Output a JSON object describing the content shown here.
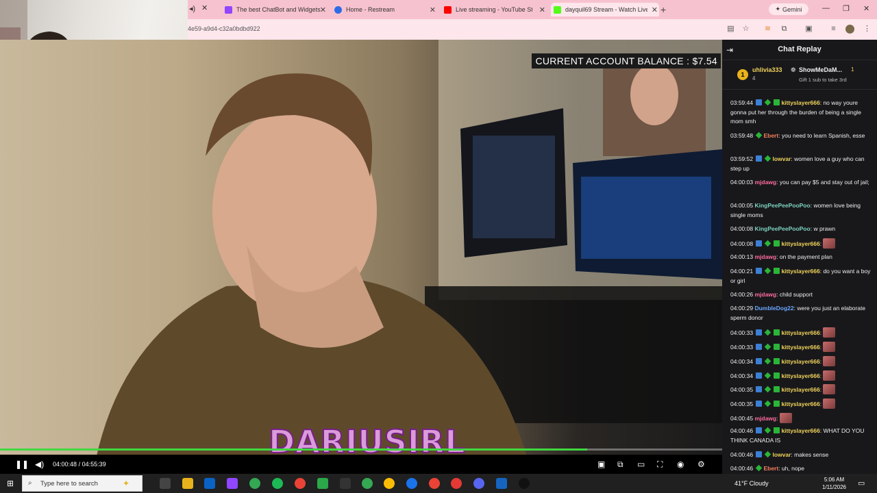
{
  "browser": {
    "tabs": [
      {
        "label": "The best ChatBot and Widgets",
        "icon": "twitch-icon",
        "color": "#9146ff"
      },
      {
        "label": "Home - Restream",
        "icon": "restream-icon",
        "color": "#2e6be6"
      },
      {
        "label": "Live streaming - YouTube Studio",
        "icon": "youtube-icon",
        "color": "#ff0000"
      },
      {
        "label": "dayquil69 Stream - Watch Live",
        "icon": "kick-icon",
        "color": "#53fc18"
      }
    ],
    "gemini_label": "Gemini",
    "url": "4e59-a9d4-c32a0bdbd922"
  },
  "video": {
    "balance_text": "CURRENT ACCOUNT BALANCE : $7.54",
    "overlay_name": "DARIUSIRL",
    "progress": 0.813,
    "time_current": "04:00:48",
    "time_sep": "/",
    "time_total": "04:55:39"
  },
  "chat": {
    "title": "Chat Replay",
    "leaderboard": {
      "first_name": "uhlivia333",
      "first_count": "4",
      "rank_number": "1",
      "second_name": "ShowMeDaM...",
      "second_count": "1",
      "gift_text": "Gift 1 sub to take 3rd"
    },
    "messages": [
      {
        "ts": "03:59:44",
        "user": "kittyslayer666",
        "color": "#f0d35a",
        "badges": [
          "blue",
          "green",
          "sub"
        ],
        "text": " no way youre gonna put her through the burden of being a single mom smh"
      },
      {
        "ts": "03:59:48",
        "user": "Ebert",
        "color": "#f77f5d",
        "badges": [
          "green"
        ],
        "text": " you need to learn Spanish, esse"
      },
      {
        "ts": "03:59:52",
        "user": "lowvar",
        "color": "#f0d35a",
        "badges": [
          "blue",
          "green"
        ],
        "text": " women love a guy who can step up"
      },
      {
        "ts": "04:00:03",
        "user": "mjdawg",
        "color": "#ff6b9d",
        "badges": [],
        "text": " you can pay $5 and stay out of jail;"
      },
      {
        "ts": "04:00:05",
        "user": "KingPeePeePooPoo",
        "color": "#7dd3c0",
        "badges": [],
        "text": " women love being single moms"
      },
      {
        "ts": "04:00:08",
        "user": "KingPeePeePooPoo",
        "color": "#7dd3c0",
        "badges": [],
        "text": " w prawn"
      },
      {
        "ts": "04:00:08",
        "user": "kittyslayer666",
        "color": "#f0d35a",
        "badges": [
          "blue",
          "green",
          "sub"
        ],
        "text": " ",
        "emote": true
      },
      {
        "ts": "04:00:13",
        "user": "mjdawg",
        "color": "#ff6b9d",
        "badges": [],
        "text": " on the payment plan"
      },
      {
        "ts": "04:00:21",
        "user": "kittyslayer666",
        "color": "#f0d35a",
        "badges": [
          "blue",
          "green",
          "sub"
        ],
        "text": " do you want a boy or girl"
      },
      {
        "ts": "04:00:26",
        "user": "mjdawg",
        "color": "#ff6b9d",
        "badges": [],
        "text": " child support"
      },
      {
        "ts": "04:00:29",
        "user": "DumbleDog22",
        "color": "#6aa7ff",
        "badges": [],
        "text": " were you just an elaborate sperm donor"
      },
      {
        "ts": "04:00:33",
        "user": "kittyslayer666",
        "color": "#f0d35a",
        "badges": [
          "blue",
          "green",
          "sub"
        ],
        "text": " ",
        "emote": true
      },
      {
        "ts": "04:00:33",
        "user": "kittyslayer666",
        "color": "#f0d35a",
        "badges": [
          "blue",
          "green",
          "sub"
        ],
        "text": " ",
        "emote": true
      },
      {
        "ts": "04:00:34",
        "user": "kittyslayer666",
        "color": "#f0d35a",
        "badges": [
          "blue",
          "green",
          "sub"
        ],
        "text": " ",
        "emote": true
      },
      {
        "ts": "04:00:34",
        "user": "kittyslayer666",
        "color": "#f0d35a",
        "badges": [
          "blue",
          "green",
          "sub"
        ],
        "text": " ",
        "emote": true
      },
      {
        "ts": "04:00:35",
        "user": "kittyslayer666",
        "color": "#f0d35a",
        "badges": [
          "blue",
          "green",
          "sub"
        ],
        "text": " ",
        "emote": true
      },
      {
        "ts": "04:00:35",
        "user": "kittyslayer666",
        "color": "#f0d35a",
        "badges": [
          "blue",
          "green",
          "sub"
        ],
        "text": " ",
        "emote": true
      },
      {
        "ts": "04:00:45",
        "user": "mjdawg",
        "color": "#ff6b9d",
        "badges": [],
        "text": " ",
        "emote": true
      },
      {
        "ts": "04:00:46",
        "user": "kittyslayer666",
        "color": "#f0d35a",
        "badges": [
          "blue",
          "green",
          "sub"
        ],
        "text": " WHAT DO YOU THINK CANADA IS"
      },
      {
        "ts": "04:00:46",
        "user": "lowvar",
        "color": "#f0d35a",
        "badges": [
          "blue",
          "green"
        ],
        "text": " makes sense"
      },
      {
        "ts": "04:00:46",
        "user": "Ebert",
        "color": "#f77f5d",
        "badges": [
          "green"
        ],
        "text": " uh, nope"
      }
    ]
  },
  "taskbar": {
    "search_placeholder": "Type here to search",
    "weather": "41°F  Cloudy",
    "time": "5:06 AM",
    "date": "1/11/2026"
  }
}
